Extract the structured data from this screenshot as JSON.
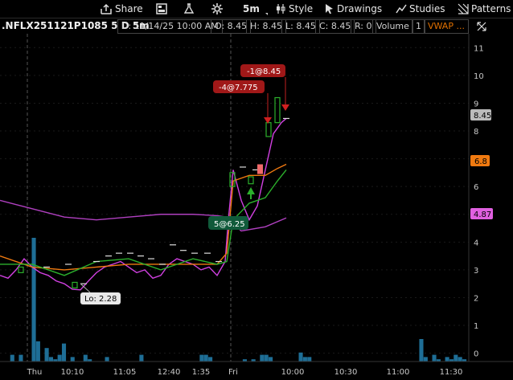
{
  "toolbar": {
    "share": "Share",
    "interval": "5m",
    "style": "Style",
    "drawings": "Drawings",
    "studies": "Studies",
    "patterns": "Patterns"
  },
  "infobar": {
    "symbol": ".NFLX251121P1085 5 D 5m",
    "date": "D: 11/14/25 10:00 AM",
    "open": "O: 8.45",
    "high": "H: 8.45",
    "low": "L: 8.45",
    "close": "C: 8.45",
    "range": "R: 0",
    "volume_label": "Volume",
    "volume_value": "1",
    "vwap": "VWAP ..."
  },
  "colors": {
    "background": "#000000",
    "price_line": "#d040e0",
    "ma_orange": "#f07a10",
    "ma_green": "#2cb02c",
    "vwap_purple": "#b040c0",
    "volume": "#1e6e96",
    "sell_label": "#a01818",
    "buy_label": "#105a3a"
  },
  "price_badges": {
    "last": "8.45",
    "orange": "6.8",
    "purple": "4.87"
  },
  "annotations": {
    "lo": "Lo: 2.28",
    "sell1": "-1@8.45",
    "sell2": "-4@7.775",
    "buy": "5@6.25"
  },
  "chart_data": {
    "type": "line",
    "y_axis_ticks": [
      "0",
      "1",
      "2",
      "3",
      "4",
      "5",
      "6",
      "7",
      "8",
      "9",
      "10",
      "11"
    ],
    "ylim": [
      -0.3,
      11.5
    ],
    "x_axis_ticks": [
      "Thu",
      "10:10",
      "11:05",
      "12:40",
      "1:35",
      "Fri",
      "10:00",
      "10:30",
      "11:00",
      "11:30"
    ],
    "series": [
      {
        "name": "price",
        "x": [
          0,
          10,
          20,
          30,
          40,
          50,
          60,
          70,
          80,
          90,
          100,
          110,
          120,
          130,
          140,
          150,
          160,
          170,
          180,
          190,
          200,
          210,
          220,
          230,
          240,
          250,
          260,
          270,
          280,
          284,
          290,
          300,
          310,
          320,
          330,
          340,
          350,
          356
        ],
        "y": [
          2.8,
          2.7,
          3.0,
          3.4,
          3.1,
          2.9,
          2.8,
          2.6,
          2.5,
          2.3,
          2.28,
          2.6,
          2.9,
          3.1,
          3.2,
          3.3,
          3.1,
          2.9,
          3.0,
          2.7,
          2.8,
          3.2,
          3.4,
          3.3,
          3.2,
          3.0,
          3.1,
          2.8,
          3.3,
          4.8,
          6.6,
          5.5,
          4.8,
          5.3,
          6.6,
          7.9,
          8.3,
          8.45
        ]
      },
      {
        "name": "ma_orange",
        "x": [
          0,
          40,
          80,
          120,
          160,
          200,
          240,
          270,
          282,
          290,
          310,
          330,
          345,
          356
        ],
        "y": [
          3.5,
          3.1,
          3.0,
          3.1,
          3.2,
          3.2,
          3.2,
          3.2,
          3.6,
          6.2,
          6.4,
          6.4,
          6.65,
          6.8
        ]
      },
      {
        "name": "ma_green",
        "x": [
          0,
          40,
          80,
          120,
          160,
          200,
          240,
          270,
          282,
          290,
          310,
          330,
          345,
          356
        ],
        "y": [
          3.2,
          3.2,
          2.8,
          3.3,
          3.4,
          3.0,
          3.4,
          3.2,
          3.3,
          4.8,
          5.4,
          5.6,
          6.2,
          6.6
        ]
      },
      {
        "name": "vwap",
        "x": [
          0,
          40,
          80,
          120,
          160,
          200,
          240,
          270,
          282,
          300,
          330,
          356
        ],
        "y": [
          5.5,
          5.2,
          4.9,
          4.8,
          4.9,
          5.0,
          5.0,
          4.95,
          4.9,
          4.4,
          4.55,
          4.87
        ]
      }
    ],
    "volume_bars": [
      0,
      0,
      0.3,
      0,
      0.3,
      0,
      0,
      5.5,
      0.9,
      0,
      0.6,
      0.2,
      0.1,
      0.3,
      0.8,
      0,
      0.2,
      0,
      0,
      0.3,
      0.1,
      0,
      0,
      0,
      0.2,
      0,
      0,
      0,
      0,
      0,
      0,
      0,
      0.3,
      0,
      0,
      0,
      0,
      0,
      0,
      0,
      0,
      0,
      0,
      0,
      0,
      0,
      0.3,
      0.3,
      0.2,
      0,
      0,
      0,
      0,
      0,
      0,
      0,
      0.1,
      0,
      0.1,
      0,
      0.3,
      0.3,
      0.2,
      0,
      0,
      0,
      0,
      0,
      0,
      0.4,
      0.2,
      0.2,
      0,
      0,
      0,
      0,
      0,
      0,
      0,
      0,
      0,
      0,
      0,
      0,
      0,
      0,
      0,
      0,
      0,
      0,
      0,
      0,
      0,
      0,
      0,
      0,
      0,
      1.0,
      0.2,
      0,
      0.3,
      0.1,
      0,
      0.2,
      0.1,
      0.3,
      0.2,
      0.1,
      0.1,
      0.1
    ]
  }
}
